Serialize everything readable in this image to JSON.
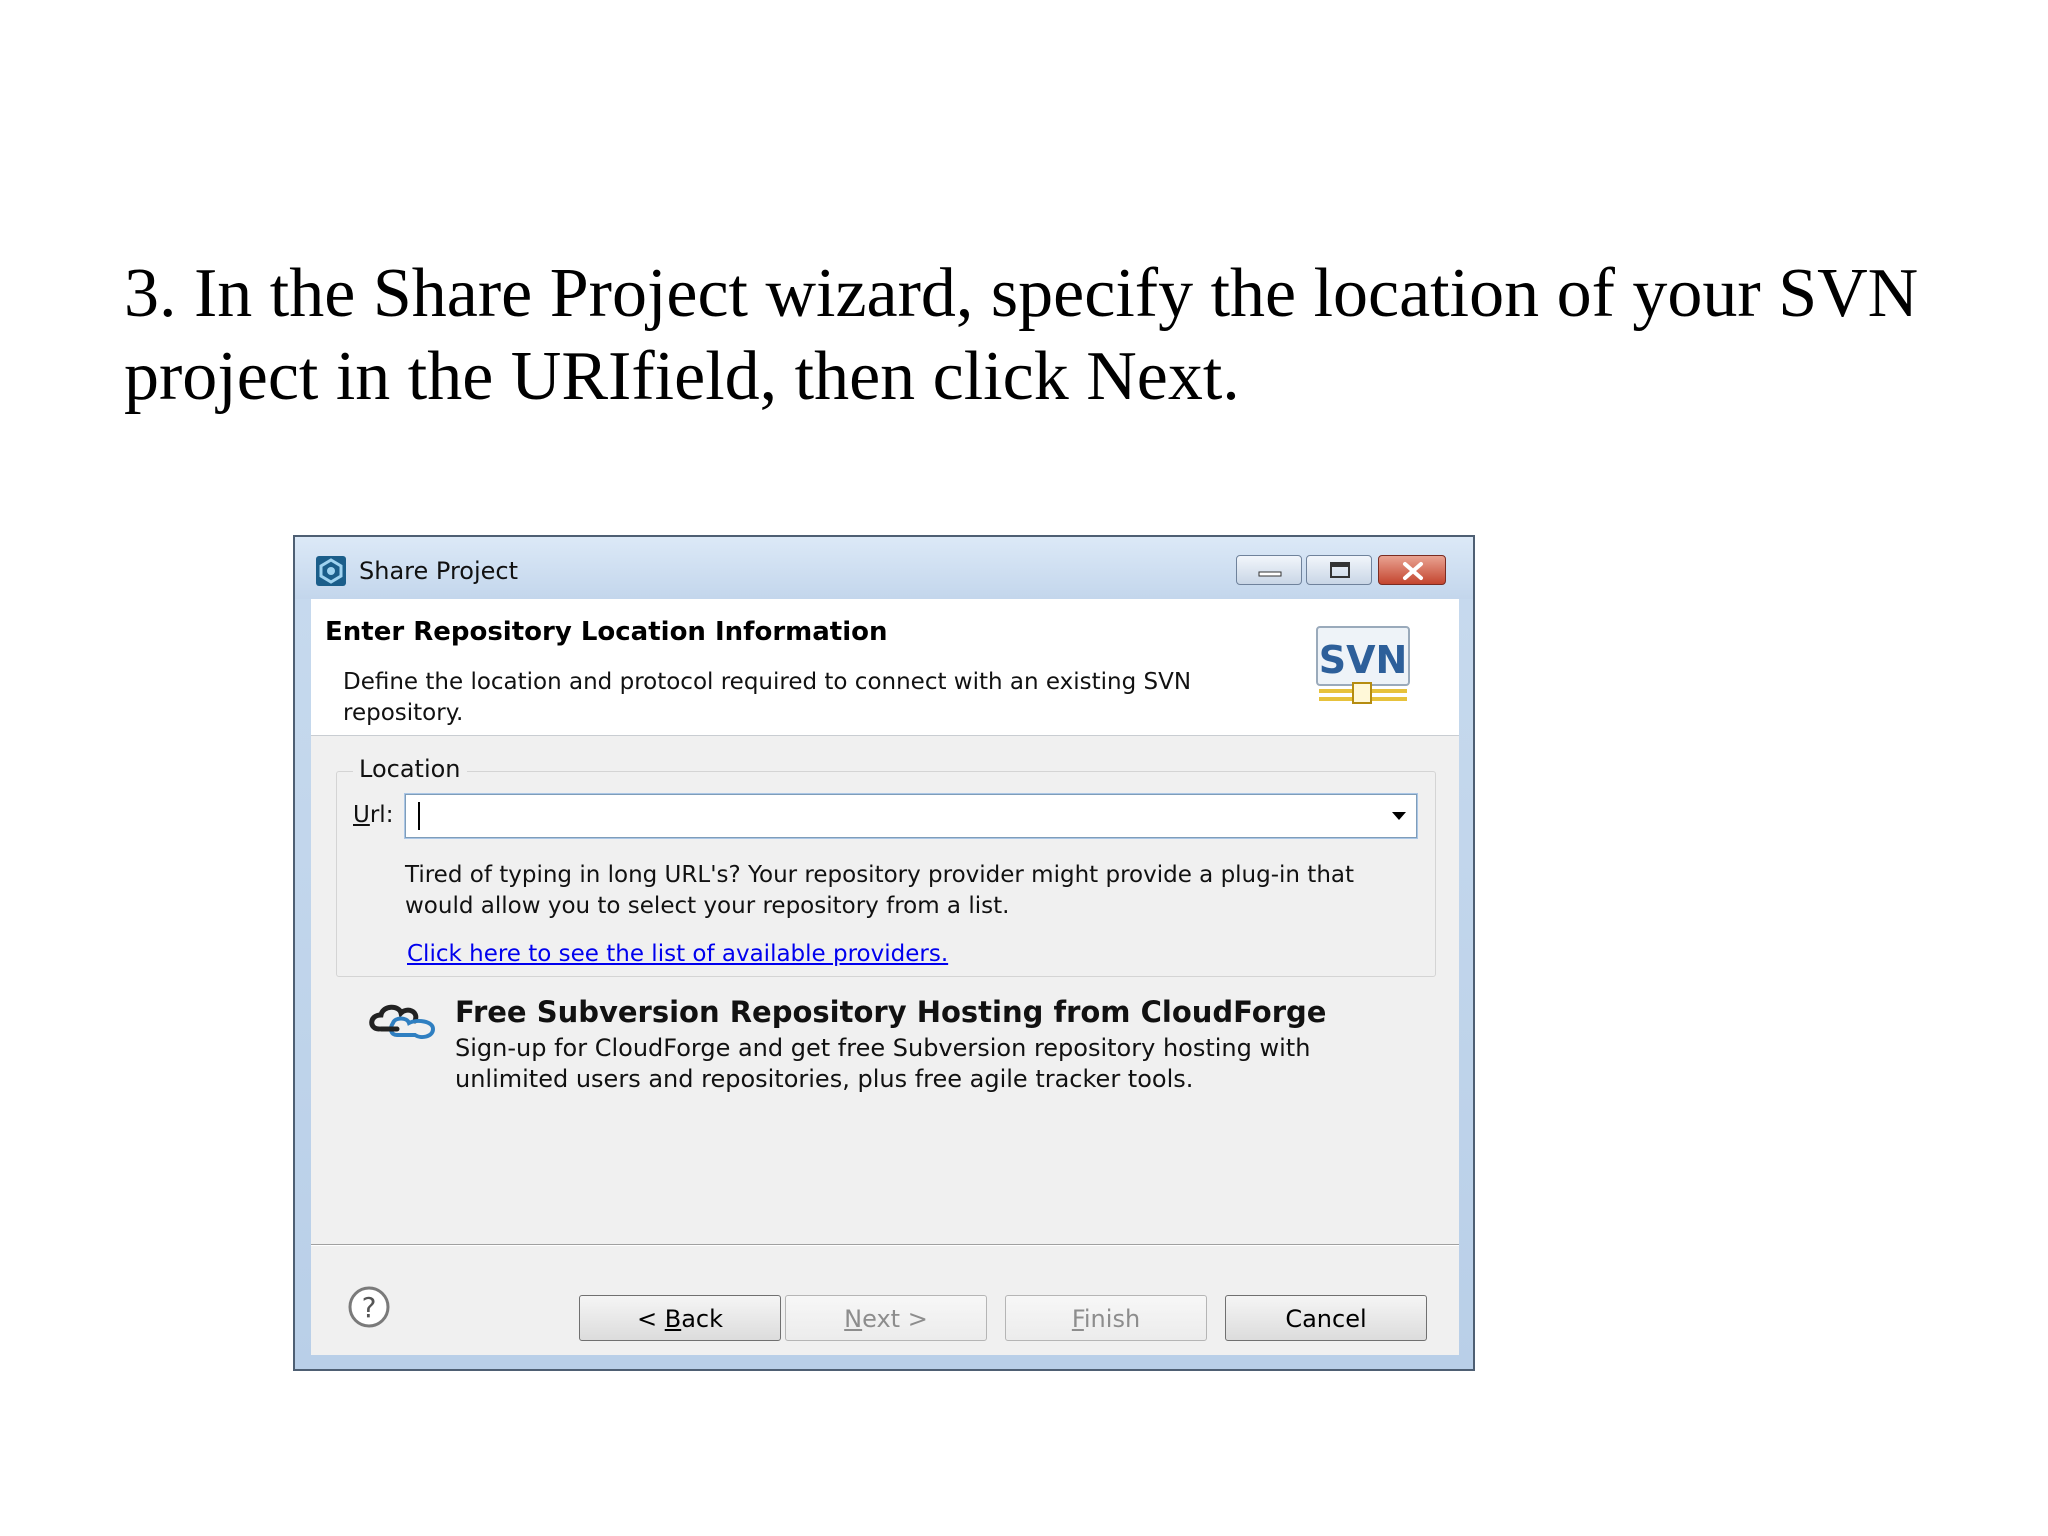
{
  "slide": {
    "instruction_line1": "3. In the Share Project wizard, specify the location of your SVN",
    "instruction_line2": "project in the URIfield, then click Next."
  },
  "window": {
    "title": "Share Project",
    "controls": [
      "minimize-icon",
      "maximize-icon",
      "close-icon"
    ]
  },
  "banner": {
    "title": "Enter Repository Location Information",
    "description": "Define the location and protocol required to connect with an existing SVN repository.",
    "logo_text": "SVN"
  },
  "location": {
    "group_label": "Location",
    "url_label_key": "U",
    "url_label_rest": "rl:",
    "url_value": "",
    "url_placeholder": "",
    "hint": "Tired of typing in long URL's?  Your repository provider might provide a plug-in that would allow you to select your repository from a list.",
    "providers_link": "Click here to see the list of available providers."
  },
  "cloudforge": {
    "title": "Free Subversion Repository Hosting from CloudForge",
    "description": "Sign-up for CloudForge and get free Subversion repository hosting with unlimited users and repositories, plus free agile tracker tools."
  },
  "buttons": {
    "back_prefix": "< ",
    "back_key": "B",
    "back_rest": "ack",
    "next_key": "N",
    "next_rest": "ext >",
    "finish_key": "F",
    "finish_rest": "inish",
    "cancel": "Cancel"
  },
  "colors": {
    "link": "#0000ee",
    "dialog_frame": "#b9cfe8",
    "close_button": "#c4452f"
  }
}
